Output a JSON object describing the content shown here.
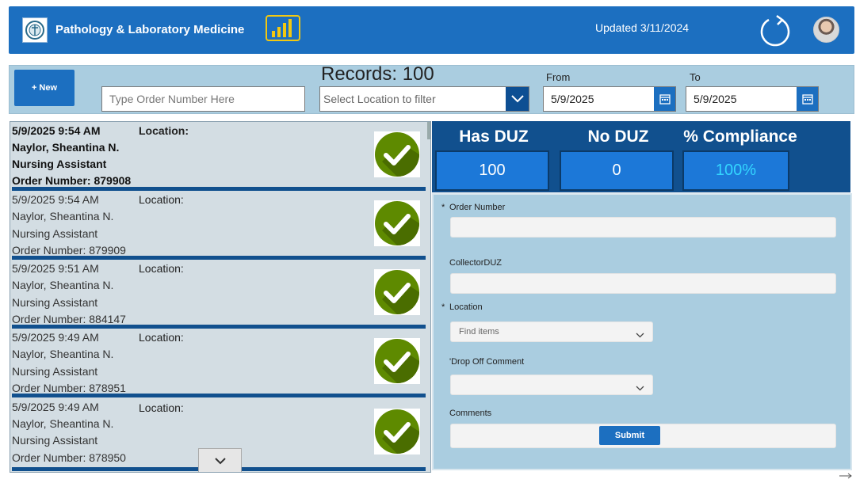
{
  "header": {
    "title": "Pathology & Laboratory Medicine",
    "updated": "Updated 3/11/2024",
    "logo_icon": "department-seal-icon",
    "report_icon": "power-bi-icon",
    "refresh_icon": "refresh-icon"
  },
  "filters": {
    "new_label": "+ New",
    "records": "Records: 100",
    "order_placeholder": "Type Order Number Here",
    "location_placeholder": "Select Location to filter",
    "from_label": "From",
    "from_value": "5/9/2025",
    "to_label": "To",
    "to_value": "5/9/2025"
  },
  "records": [
    {
      "datetime": "5/9/2025 9:54 AM",
      "location_label": "Location:",
      "name": "Naylor, Sheantina N.",
      "role": "Nursing Assistant",
      "order": "Order Number: 879908"
    },
    {
      "datetime": "5/9/2025 9:54 AM",
      "location_label": "Location:",
      "name": "Naylor, Sheantina N.",
      "role": "Nursing Assistant",
      "order": "Order Number: 879909"
    },
    {
      "datetime": "5/9/2025 9:51 AM",
      "location_label": "Location:",
      "name": "Naylor, Sheantina N.",
      "role": "Nursing Assistant",
      "order": "Order Number: 884147"
    },
    {
      "datetime": "5/9/2025 9:49 AM",
      "location_label": "Location:",
      "name": "Naylor, Sheantina N.",
      "role": "Nursing Assistant",
      "order": "Order Number: 878951"
    },
    {
      "datetime": "5/9/2025 9:49 AM",
      "location_label": "Location:",
      "name": "Naylor, Sheantina N.",
      "role": "Nursing Assistant",
      "order": "Order Number: 878950"
    }
  ],
  "stats": {
    "has_duz_label": "Has DUZ",
    "has_duz_value": "100",
    "no_duz_label": "No DUZ",
    "no_duz_value": "0",
    "compliance_label": "% Compliance",
    "compliance_value": "100%",
    "compliance_color": "#33d6ff"
  },
  "form": {
    "required_mark": "*",
    "order_label": "Order Number",
    "collector_label": "CollectorDUZ",
    "location_label": "Location",
    "location_placeholder": "Find items",
    "dropoff_label": "'Drop Off Comment",
    "comments_label": "Comments",
    "submit_label": "Submit"
  },
  "colors": {
    "primary": "#1c6fc0",
    "dark_blue": "#11508e",
    "panel": "#aacde0",
    "check_green": "#5e8a00"
  }
}
